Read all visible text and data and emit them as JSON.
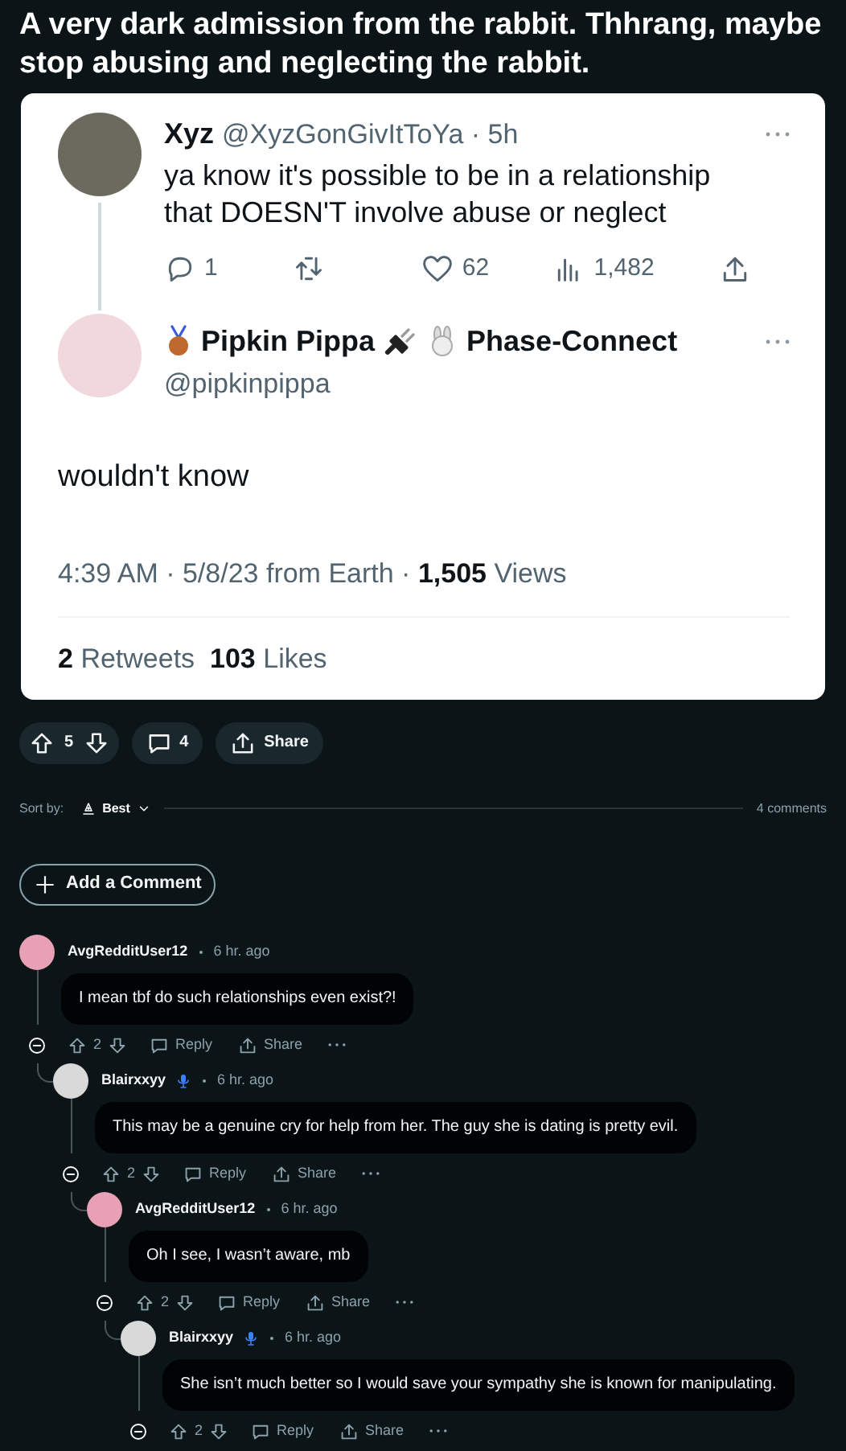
{
  "post": {
    "title": "A very dark admission from the rabbit. Thhrang, maybe stop abusing and neglecting the rabbit."
  },
  "embedded_screenshot": {
    "reply_to": {
      "name": "Xyz",
      "handle_line": "@XyzGonGivItToYa · 5h",
      "text": "ya know it's possible to be in a relationship that DOESN'T involve abuse or neglect",
      "stats": [
        {
          "kind": "reply",
          "count": "1"
        },
        {
          "kind": "retweet"
        },
        {
          "kind": "like",
          "count": "62"
        },
        {
          "kind": "views",
          "count": "1,482"
        },
        {
          "kind": "share"
        }
      ]
    },
    "tweet": {
      "name": "Pipkin Pippa",
      "name_suffix": "Phase-Connect",
      "handle": "@pipkinpippa",
      "text": "wouldn't know",
      "timestamp": "4:39 AM · 5/8/23 from Earth · **1,505** Views",
      "metrics": "**2** Retweets  **103** Likes"
    }
  },
  "post_actions": {
    "votes": "5",
    "comments": "4",
    "share": "Share"
  },
  "sort": {
    "label": "Sort by:",
    "value": "Best",
    "count": "4 comments"
  },
  "add_comment": "Add a Comment",
  "comments": [
    {
      "author": "AvgRedditUser12",
      "mic_badge": false,
      "time": "6 hr. ago",
      "text": "I mean tbf do such relationships even exist?!",
      "votes": "2",
      "reply": "Reply",
      "share": "Share",
      "children": [
        {
          "author": "Blairxxyy",
          "mic_badge": true,
          "time": "6 hr. ago",
          "text": "This may be a genuine cry for help from her. The guy she is dating is pretty evil.",
          "votes": "2",
          "reply": "Reply",
          "share": "Share",
          "children": [
            {
              "author": "AvgRedditUser12",
              "mic_badge": false,
              "time": "6 hr. ago",
              "text": "Oh I see, I wasn’t aware, mb",
              "votes": "2",
              "reply": "Reply",
              "share": "Share",
              "children": [
                {
                  "author": "Blairxxyy",
                  "mic_badge": true,
                  "time": "6 hr. ago",
                  "text": "She isn’t much better so I would save your sympathy she is known for manipulating.",
                  "votes": "2",
                  "reply": "Reply",
                  "share": "Share"
                }
              ]
            }
          ]
        }
      ]
    }
  ]
}
